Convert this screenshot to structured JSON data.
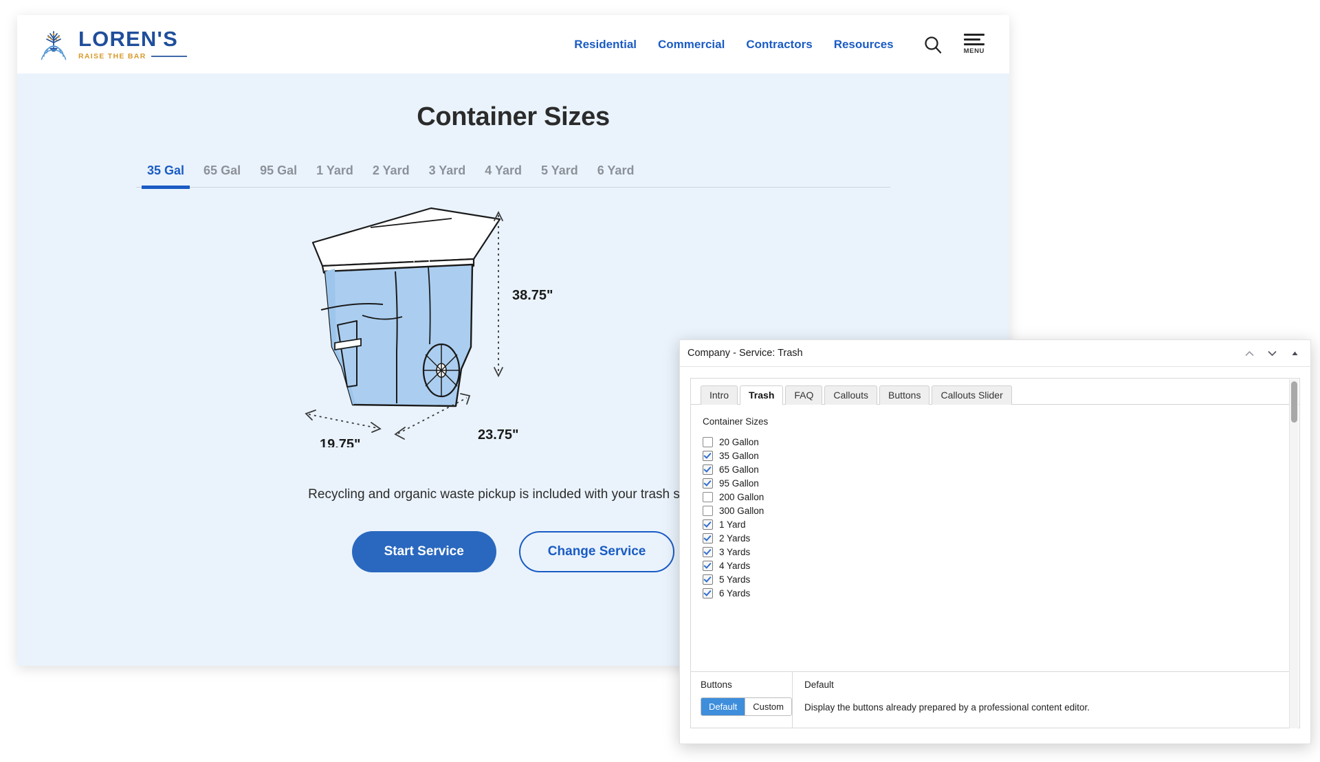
{
  "site": {
    "logo": {
      "name": "LOREN'S",
      "tagline": "RAISE THE BAR",
      "mark": "tree-logo-icon"
    },
    "nav": {
      "links": [
        "Residential",
        "Commercial",
        "Contractors",
        "Resources"
      ],
      "search_icon": "search-icon",
      "menu_icon": "hamburger-menu-icon",
      "menu_label": "MENU"
    },
    "page_title": "Container Sizes",
    "tabs": [
      {
        "label": "35 Gal",
        "active": true
      },
      {
        "label": "65 Gal",
        "active": false
      },
      {
        "label": "95 Gal",
        "active": false
      },
      {
        "label": "1 Yard",
        "active": false
      },
      {
        "label": "2 Yard",
        "active": false
      },
      {
        "label": "3 Yard",
        "active": false
      },
      {
        "label": "4 Yard",
        "active": false
      },
      {
        "label": "5 Yard",
        "active": false
      },
      {
        "label": "6 Yard",
        "active": false
      }
    ],
    "container": {
      "height_label": "38.75\"",
      "width_label": "19.75\"",
      "depth_label": "23.75\"",
      "body_color": "#ABCEF0",
      "lid_color": "#FFFFFF"
    },
    "tagline_text": "Recycling and organic waste pickup is included with your trash service.",
    "buttons": {
      "primary": "Start Service",
      "secondary": "Change Service",
      "primary_color": "#2A68BF",
      "secondary_color": "#1A5BC4"
    },
    "colors": {
      "body_bg": "#EAF3FC",
      "link": "#1A5BC4",
      "accent_gold": "#D79A2B"
    }
  },
  "panel": {
    "title": "Company - Service: Trash",
    "controls": [
      "chevron-up-icon",
      "chevron-down-icon",
      "triangle-up-icon"
    ],
    "tabs": [
      {
        "label": "Intro",
        "active": false
      },
      {
        "label": "Trash",
        "active": true
      },
      {
        "label": "FAQ",
        "active": false
      },
      {
        "label": "Callouts",
        "active": false
      },
      {
        "label": "Buttons",
        "active": false
      },
      {
        "label": "Callouts Slider",
        "active": false
      }
    ],
    "section_label": "Container Sizes",
    "checkboxes": [
      {
        "label": "20 Gallon",
        "checked": false
      },
      {
        "label": "35 Gallon",
        "checked": true
      },
      {
        "label": "65 Gallon",
        "checked": true
      },
      {
        "label": "95 Gallon",
        "checked": true
      },
      {
        "label": "200 Gallon",
        "checked": false
      },
      {
        "label": "300 Gallon",
        "checked": false
      },
      {
        "label": "1 Yard",
        "checked": true
      },
      {
        "label": "2 Yards",
        "checked": true
      },
      {
        "label": "3 Yards",
        "checked": true
      },
      {
        "label": "4 Yards",
        "checked": true
      },
      {
        "label": "5 Yards",
        "checked": true
      },
      {
        "label": "6 Yards",
        "checked": true
      }
    ],
    "buttons_section": {
      "label": "Buttons",
      "options": [
        {
          "label": "Default",
          "active": true
        },
        {
          "label": "Custom",
          "active": false
        }
      ],
      "detail_title": "Default",
      "detail_desc": "Display the buttons already prepared by a professional content editor."
    }
  }
}
